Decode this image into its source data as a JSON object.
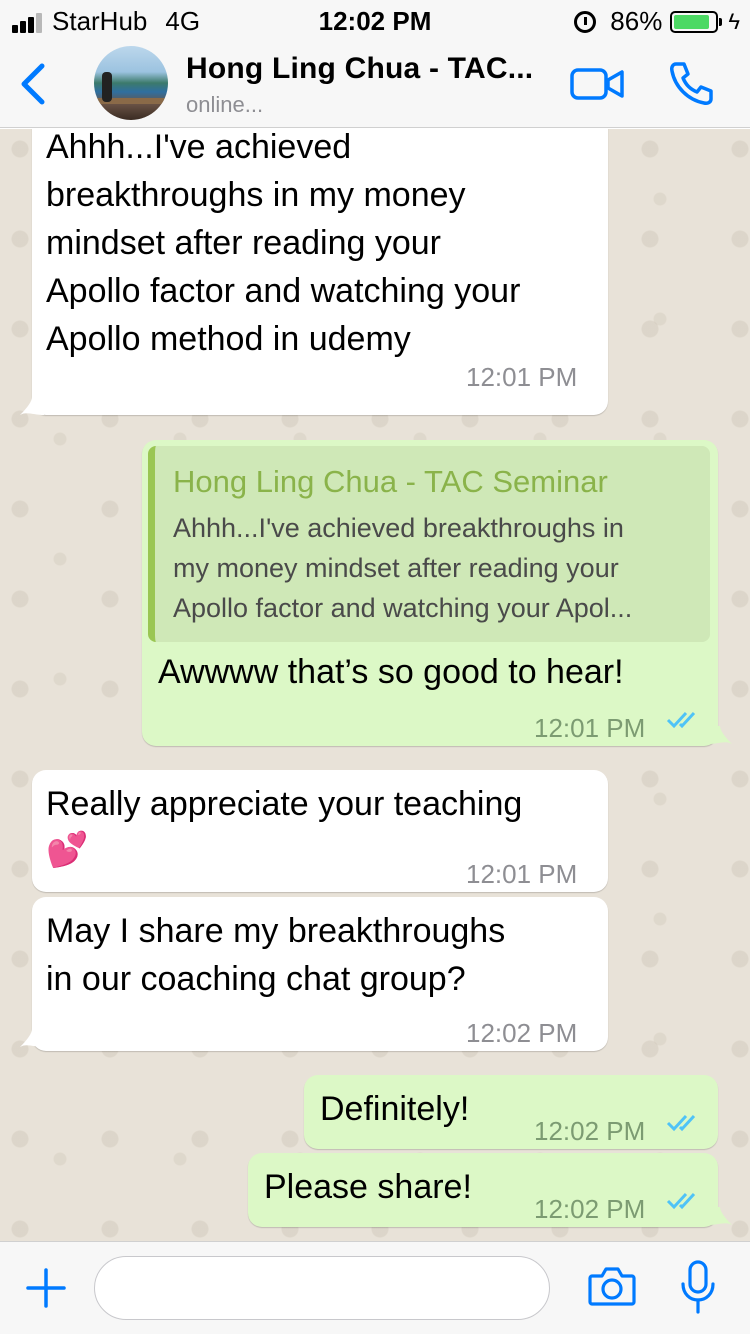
{
  "status_bar": {
    "carrier": "StarHub",
    "network": "4G",
    "time": "12:02 PM",
    "battery_percent": "86%",
    "battery_level": 0.86
  },
  "header": {
    "contact_name": "Hong Ling Chua - TAC...",
    "status": "online..."
  },
  "messages": [
    {
      "direction": "incoming",
      "lines": [
        "Ahhh...I've achieved",
        "breakthroughs in my money",
        "mindset after reading your",
        "Apollo factor and watching your",
        "Apollo method in udemy"
      ],
      "time": "12:01 PM"
    },
    {
      "direction": "outgoing",
      "quote_name": "Hong Ling Chua - TAC Seminar",
      "quote_lines": [
        "Ahhh...I've achieved breakthroughs in",
        "my money mindset after reading your",
        "Apollo factor and watching your Apol..."
      ],
      "text": "Awwww that’s so good to hear!",
      "time": "12:01 PM",
      "read": true
    },
    {
      "direction": "incoming",
      "text": "Really appreciate your teaching",
      "emoji": "💕",
      "time": "12:01 PM"
    },
    {
      "direction": "incoming",
      "lines": [
        "May I share my breakthroughs",
        "in our coaching chat group?"
      ],
      "time": "12:02 PM"
    },
    {
      "direction": "outgoing",
      "text": "Definitely!",
      "time": "12:02 PM",
      "read": true
    },
    {
      "direction": "outgoing",
      "text": "Please share!",
      "time": "12:02 PM",
      "read": true
    }
  ],
  "input": {
    "value": "",
    "placeholder": ""
  },
  "colors": {
    "accent": "#007aff",
    "outgoing_bubble": "#dcf8c6",
    "incoming_bubble": "#ffffff",
    "read_ticks": "#4fc3f7",
    "quote_name": "#8ab34a"
  },
  "icons": [
    "back-icon",
    "video-call-icon",
    "phone-call-icon",
    "plus-icon",
    "camera-icon",
    "microphone-icon",
    "alarm-icon",
    "battery-icon",
    "read-receipt-icon"
  ]
}
